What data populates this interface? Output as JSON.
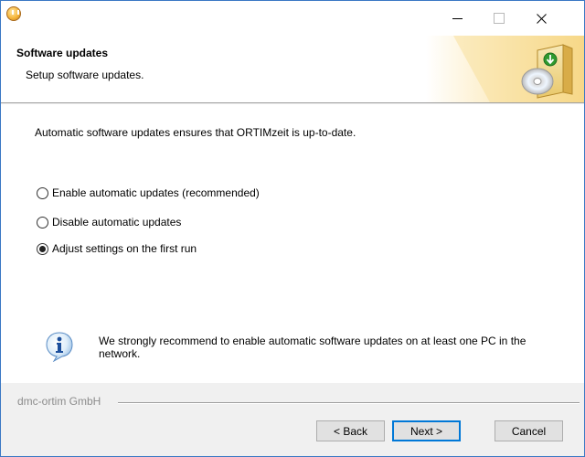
{
  "window": {
    "close_glyph": "✕"
  },
  "header": {
    "title": "Software updates",
    "subtitle": "Setup software updates."
  },
  "content": {
    "intro": "Automatic software updates ensures that ORTIMzeit is up-to-date.",
    "options": [
      {
        "label": "Enable automatic updates (recommended)",
        "checked": false
      },
      {
        "label": "Disable automatic updates",
        "checked": false
      },
      {
        "label": "Adjust settings on the first run",
        "checked": true
      }
    ],
    "info_text": "We strongly recommend to enable automatic software updates on at least one PC in the network."
  },
  "footer": {
    "company": "dmc-ortim GmbH",
    "back_label": "< Back",
    "next_label": "Next >",
    "cancel_label": "Cancel"
  },
  "colors": {
    "accent": "#0078d7",
    "header_bg": "#ffffff",
    "dialog_bg": "#f0f0f0",
    "banner_gold": "#f3c45a"
  },
  "icons": {
    "app": "installer-icon",
    "banner": "software-box-cd-icon",
    "info": "information-icon"
  }
}
